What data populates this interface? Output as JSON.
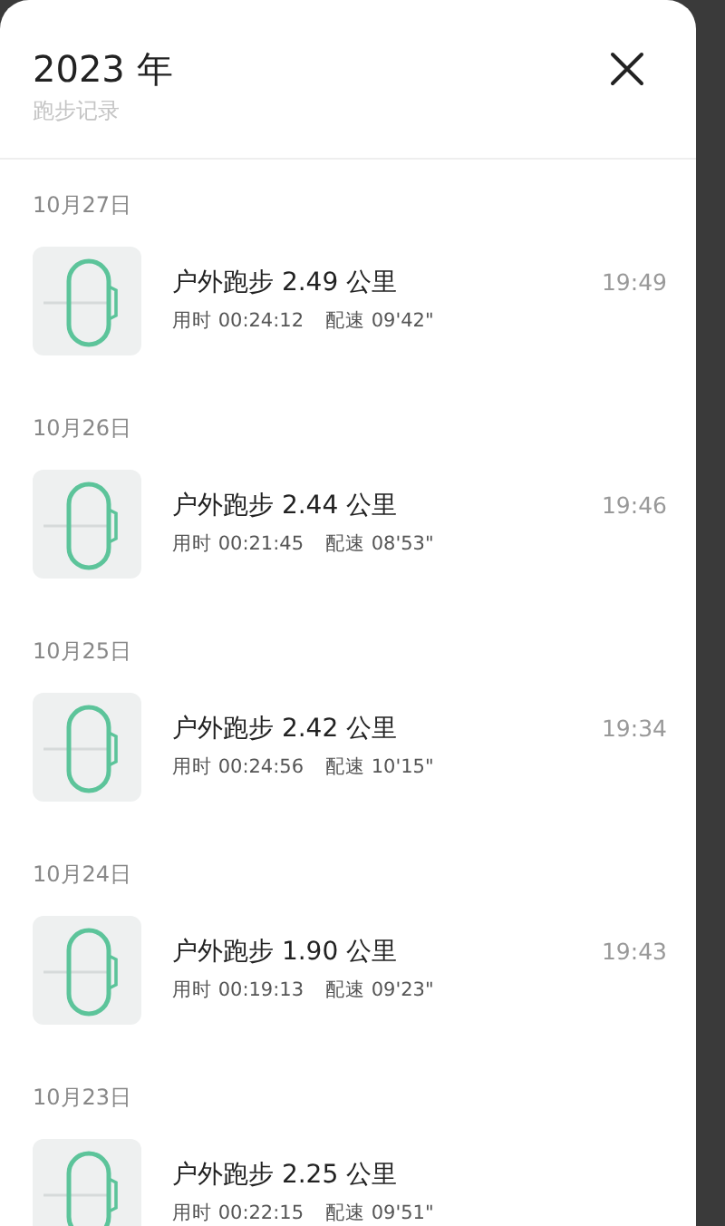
{
  "header": {
    "title": "2023 年",
    "subtitle": "跑步记录"
  },
  "groups": [
    {
      "date": "10月27日",
      "records": [
        {
          "title": "户外跑步 2.49 公里",
          "duration": "用时 00:24:12",
          "pace": "配速 09'42\"",
          "time": "19:49"
        }
      ]
    },
    {
      "date": "10月26日",
      "records": [
        {
          "title": "户外跑步 2.44 公里",
          "duration": "用时 00:21:45",
          "pace": "配速 08'53\"",
          "time": "19:46"
        }
      ]
    },
    {
      "date": "10月25日",
      "records": [
        {
          "title": "户外跑步 2.42 公里",
          "duration": "用时 00:24:56",
          "pace": "配速 10'15\"",
          "time": "19:34"
        }
      ]
    },
    {
      "date": "10月24日",
      "records": [
        {
          "title": "户外跑步 1.90 公里",
          "duration": "用时 00:19:13",
          "pace": "配速 09'23\"",
          "time": "19:43"
        }
      ]
    },
    {
      "date": "10月23日",
      "records": [
        {
          "title": "户外跑步 2.25 公里",
          "duration": "用时 00:22:15",
          "pace": "配速 09'51\""
        }
      ]
    }
  ]
}
